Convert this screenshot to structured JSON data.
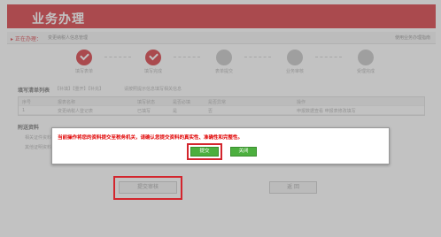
{
  "header": {
    "title": "业务办理"
  },
  "breadcrumb": {
    "label": "▸ 正在办理：",
    "path": "变更纳税人信息管理",
    "help": "使用业务办理指南"
  },
  "steps": [
    {
      "label": "填写表单",
      "done": true
    },
    {
      "label": "填写完成",
      "done": true
    },
    {
      "label": "表单提交",
      "done": false
    },
    {
      "label": "业务审核",
      "done": false
    },
    {
      "label": "受理完成",
      "done": false
    }
  ],
  "list_section": {
    "title": "填写清单列表",
    "tabs": "【补填】【重开】【补充】",
    "note": "请按照提示信息填写相关信息",
    "columns": [
      "序号",
      "报表名称",
      "填写状态",
      "是否必填",
      "是否异常",
      "",
      "操作"
    ],
    "rows": [
      [
        "1",
        "变更纳税人登记表",
        "已填写",
        "是",
        "否",
        "",
        "申报数据查看  申报表修改填写"
      ]
    ]
  },
  "attachment_section": {
    "title": "附送资料",
    "items": [
      "相关证件资料",
      "其他证明资料"
    ]
  },
  "dialog": {
    "message": "当前操作将您的资料提交至税务机关，请确认您提交资料的真实性、准确性和完整性。",
    "ok_label": "提交",
    "close_label": "关闭"
  },
  "bottom_buttons": {
    "submit_label": "提交审核",
    "back_label": "返 回"
  },
  "colors": {
    "brand_red": "#d3252d",
    "button_green": "#4caf3e",
    "warning_text": "#e00000"
  }
}
